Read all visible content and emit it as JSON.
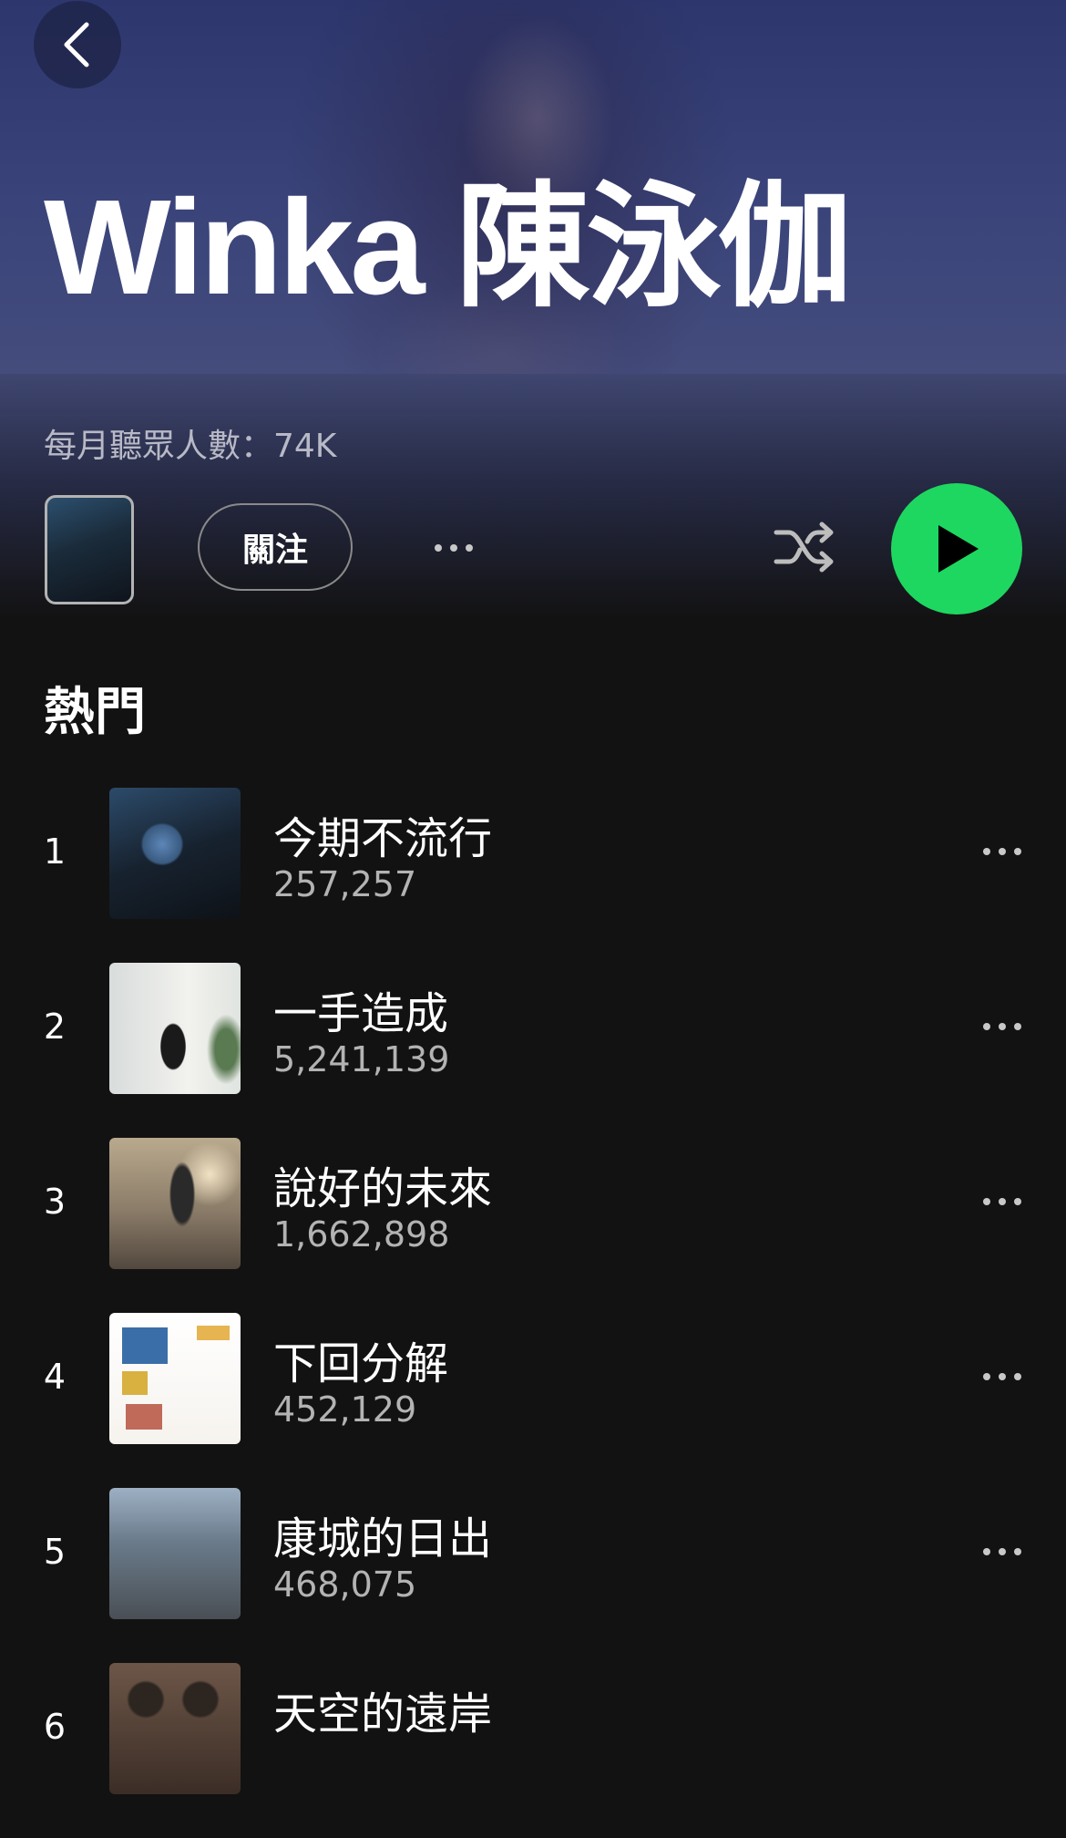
{
  "artist": {
    "name": "Winka 陳泳伽",
    "monthly_listeners": "每月聽眾人數：74K"
  },
  "actions": {
    "follow_label": "關注"
  },
  "colors": {
    "accent": "#1ed760",
    "hero": "#3a447a",
    "background": "#121212"
  },
  "section": {
    "title": "熱門"
  },
  "tracks": [
    {
      "num": "1",
      "title": "今期不流行",
      "plays": "257,257"
    },
    {
      "num": "2",
      "title": "一手造成",
      "plays": "5,241,139"
    },
    {
      "num": "3",
      "title": "說好的未來",
      "plays": "1,662,898"
    },
    {
      "num": "4",
      "title": "下回分解",
      "plays": "452,129"
    },
    {
      "num": "5",
      "title": "康城的日出",
      "plays": "468,075"
    },
    {
      "num": "6",
      "title": "天空的遠岸",
      "plays": ""
    }
  ],
  "icons": {
    "back": "chevron-left-icon",
    "more": "more-horizontal-icon",
    "shuffle": "shuffle-icon",
    "play": "play-icon"
  }
}
